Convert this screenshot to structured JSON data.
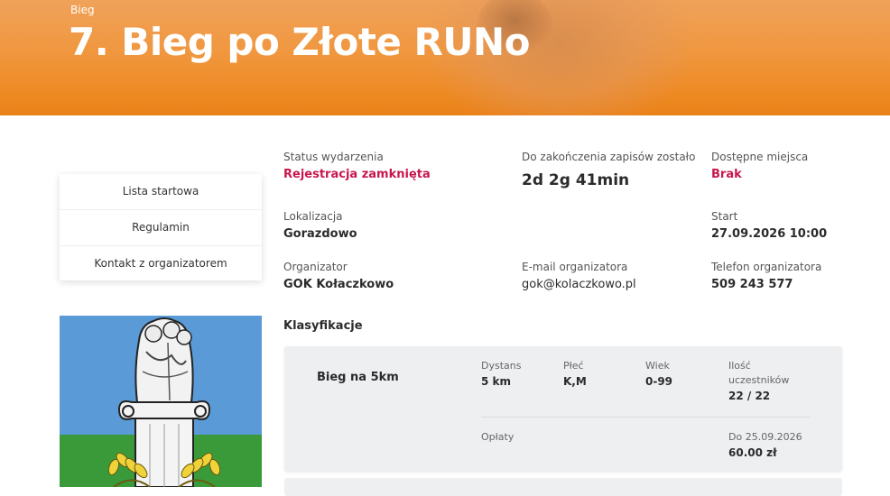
{
  "hero": {
    "kicker": "Bieg",
    "title": "7. Bieg po Złote RUNo"
  },
  "side_menu": {
    "items": [
      {
        "label": "Lista startowa"
      },
      {
        "label": "Regulamin"
      },
      {
        "label": "Kontakt z organizatorem"
      }
    ]
  },
  "event": {
    "status_label": "Status wydarzenia",
    "status_value": "Rejestracja zamknięta",
    "countdown_label": "Do zakończenia zapisów zostało",
    "countdown_value": "2d 2g 41min",
    "places_label": "Dostępne miejsca",
    "places_value": "Brak",
    "location_label": "Lokalizacja",
    "location_value": "Gorazdowo",
    "start_label": "Start",
    "start_value": "27.09.2026 10:00",
    "organizer_label": "Organizator",
    "organizer_value": "GOK Kołaczkowo",
    "email_label": "E-mail organizatora",
    "email_value": "gok@kolaczkowo.pl",
    "phone_label": "Telefon organizatora",
    "phone_value": "509 243 577"
  },
  "classifications": {
    "title": "Klasyfikacje",
    "items": [
      {
        "name": "Bieg na 5km",
        "distance_label": "Dystans",
        "distance_value": "5 km",
        "gender_label": "Płeć",
        "gender_value": "K,M",
        "age_label": "Wiek",
        "age_value": "0-99",
        "count_label_1": "Ilość",
        "count_label_2": "uczestników",
        "count_value": "22 / 22",
        "fees_label": "Opłaty",
        "fee_date_label": "Do 25.09.2026",
        "fee_value": "60.00 zł"
      }
    ]
  },
  "colors": {
    "accent_orange": "#ee8a24",
    "status_red": "#c8174d",
    "crest_blue": "#5a9ad6",
    "crest_green": "#3a9a3a"
  }
}
